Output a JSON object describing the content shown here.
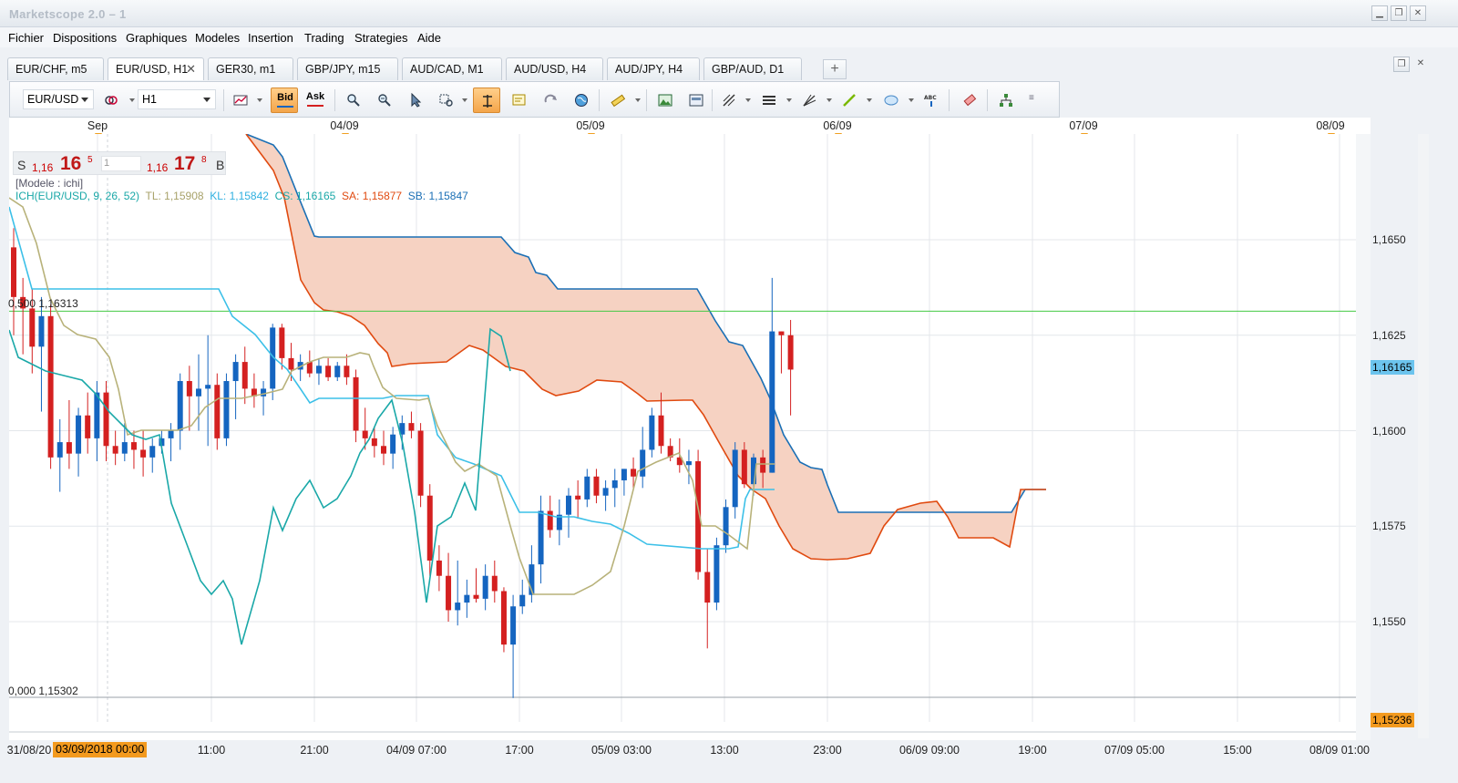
{
  "window": {
    "title": "Marketscope 2.0 – 1"
  },
  "menu": [
    "Fichier",
    "Dispositions",
    "Graphiques",
    "Modeles",
    "Insertion",
    "Trading",
    "Strategies",
    "Aide"
  ],
  "tabs": [
    "EUR/CHF, m5",
    "EUR/USD, H1",
    "GER30, m1",
    "GBP/JPY, m15",
    "AUD/CAD, M1",
    "AUD/USD, H4",
    "AUD/JPY, H4",
    "GBP/AUD, D1"
  ],
  "active_tab": 1,
  "toolbar": {
    "symbol": "EUR/USD",
    "timeframe": "H1",
    "bid_label": "Bid",
    "ask_label": "Ask"
  },
  "quote": {
    "sell_letter": "S",
    "sell_prefix": "1,16",
    "sell_big": "16",
    "sell_sup": "5",
    "lot": "1",
    "buy_prefix": "1,16",
    "buy_big": "17",
    "buy_sup": "8",
    "buy_letter": "B"
  },
  "model_label": "[Modele : ichi]",
  "ichimoku": {
    "name": "ICH(EUR/USD, 9, 26, 52)",
    "tl": "TL: 1,15908",
    "kl": "KL: 1,15842",
    "cs": "CS: 1,16165",
    "sa": "SA: 1,15877",
    "sb": "SB: 1,15847",
    "colors": {
      "tl": "#b8b27a",
      "kl": "#3cc0e8",
      "cs": "#1aa8a8",
      "sa": "#e04a10",
      "sb": "#1a6fb5",
      "cloud": "#f6d2c2"
    }
  },
  "fib": {
    "upper": "0,500 1,16313",
    "lower": "0,000 1,15302"
  },
  "date_strip": [
    "Sep",
    "04/09",
    "05/09",
    "06/09",
    "07/09",
    "08/09"
  ],
  "price_axis": [
    "1,1650",
    "1,1625",
    "1,1600",
    "1,1575",
    "1,1550"
  ],
  "price_tags": {
    "current": "1,16165",
    "low": "1,15236"
  },
  "time_axis": [
    "31/08/20",
    "03/09/2018 00:00",
    "11:00",
    "21:00",
    "04/09 07:00",
    "17:00",
    "05/09 03:00",
    "13:00",
    "23:00",
    "06/09 09:00",
    "19:00",
    "07/09 05:00",
    "15:00",
    "08/09 01:00"
  ],
  "chart_data": {
    "type": "candlestick",
    "symbol": "EUR/USD",
    "timeframe": "H1",
    "ylim": [
      1.1523,
      1.1672
    ],
    "price_ticks": [
      1.165,
      1.1625,
      1.16,
      1.1575,
      1.155
    ],
    "fib_levels": [
      {
        "label": "0,500",
        "value": 1.16313
      },
      {
        "label": "0,000",
        "value": 1.15302
      }
    ],
    "current_price": 1.16165,
    "bull_color": "#1565c0",
    "bear_color": "#d42020",
    "candles": [
      [
        1.1648,
        1.1653,
        1.1625,
        1.1635
      ],
      [
        1.1635,
        1.164,
        1.162,
        1.1632
      ],
      [
        1.1632,
        1.1637,
        1.1615,
        1.1622
      ],
      [
        1.1622,
        1.1635,
        1.1605,
        1.163
      ],
      [
        1.163,
        1.1633,
        1.159,
        1.1593
      ],
      [
        1.1593,
        1.1603,
        1.1584,
        1.1597
      ],
      [
        1.1597,
        1.1608,
        1.159,
        1.1594
      ],
      [
        1.1594,
        1.1606,
        1.1588,
        1.1604
      ],
      [
        1.1604,
        1.161,
        1.1594,
        1.1598
      ],
      [
        1.1598,
        1.1613,
        1.1592,
        1.161
      ],
      [
        1.161,
        1.1613,
        1.1592,
        1.1596
      ],
      [
        1.1596,
        1.16,
        1.1591,
        1.1594
      ],
      [
        1.1594,
        1.1602,
        1.1592,
        1.1597
      ],
      [
        1.1597,
        1.16,
        1.159,
        1.1595
      ],
      [
        1.1595,
        1.16,
        1.1588,
        1.1593
      ],
      [
        1.1593,
        1.1598,
        1.1589,
        1.1596
      ],
      [
        1.1596,
        1.16,
        1.1594,
        1.1598
      ],
      [
        1.1598,
        1.1602,
        1.1592,
        1.16
      ],
      [
        1.16,
        1.1615,
        1.1595,
        1.1613
      ],
      [
        1.1613,
        1.1617,
        1.16,
        1.1609
      ],
      [
        1.1609,
        1.162,
        1.16,
        1.1611
      ],
      [
        1.1611,
        1.1625,
        1.1596,
        1.1612
      ],
      [
        1.1612,
        1.1615,
        1.1595,
        1.1598
      ],
      [
        1.1598,
        1.1615,
        1.1596,
        1.1613
      ],
      [
        1.1613,
        1.162,
        1.1603,
        1.1618
      ],
      [
        1.1618,
        1.1622,
        1.1607,
        1.1611
      ],
      [
        1.1611,
        1.1615,
        1.1606,
        1.1609
      ],
      [
        1.1609,
        1.1613,
        1.1604,
        1.1611
      ],
      [
        1.1611,
        1.1628,
        1.1608,
        1.1627
      ],
      [
        1.1627,
        1.1628,
        1.1616,
        1.1619
      ],
      [
        1.1619,
        1.1623,
        1.1613,
        1.1616
      ],
      [
        1.1616,
        1.162,
        1.1613,
        1.1618
      ],
      [
        1.1618,
        1.1621,
        1.1614,
        1.1615
      ],
      [
        1.1615,
        1.1619,
        1.1612,
        1.1617
      ],
      [
        1.1617,
        1.1619,
        1.1613,
        1.1614
      ],
      [
        1.1614,
        1.1618,
        1.1613,
        1.1617
      ],
      [
        1.1617,
        1.162,
        1.1612,
        1.1614
      ],
      [
        1.1614,
        1.1616,
        1.1597,
        1.16
      ],
      [
        1.16,
        1.1606,
        1.1595,
        1.1598
      ],
      [
        1.1598,
        1.1601,
        1.1593,
        1.1596
      ],
      [
        1.1596,
        1.16,
        1.1591,
        1.1594
      ],
      [
        1.1594,
        1.1601,
        1.159,
        1.1599
      ],
      [
        1.1599,
        1.1604,
        1.1595,
        1.1602
      ],
      [
        1.1602,
        1.1605,
        1.1598,
        1.16
      ],
      [
        1.16,
        1.1602,
        1.158,
        1.1583
      ],
      [
        1.1583,
        1.1586,
        1.1562,
        1.1566
      ],
      [
        1.1566,
        1.157,
        1.1558,
        1.1562
      ],
      [
        1.1562,
        1.1568,
        1.155,
        1.1553
      ],
      [
        1.1553,
        1.1566,
        1.1549,
        1.1555
      ],
      [
        1.1555,
        1.1561,
        1.1551,
        1.1557
      ],
      [
        1.1557,
        1.1564,
        1.1555,
        1.1556
      ],
      [
        1.1556,
        1.1565,
        1.1553,
        1.1562
      ],
      [
        1.1562,
        1.1566,
        1.1555,
        1.1558
      ],
      [
        1.1558,
        1.1559,
        1.1542,
        1.1544
      ],
      [
        1.1544,
        1.1557,
        1.153,
        1.1554
      ],
      [
        1.1554,
        1.1561,
        1.1552,
        1.1557
      ],
      [
        1.1557,
        1.157,
        1.1555,
        1.1565
      ],
      [
        1.1565,
        1.1583,
        1.156,
        1.1579
      ],
      [
        1.1579,
        1.1583,
        1.1572,
        1.1574
      ],
      [
        1.1574,
        1.1582,
        1.157,
        1.1578
      ],
      [
        1.1578,
        1.1585,
        1.1572,
        1.1583
      ],
      [
        1.1583,
        1.1587,
        1.1577,
        1.1582
      ],
      [
        1.1582,
        1.159,
        1.158,
        1.1588
      ],
      [
        1.1588,
        1.159,
        1.1581,
        1.1583
      ],
      [
        1.1583,
        1.1587,
        1.1579,
        1.1585
      ],
      [
        1.1585,
        1.159,
        1.158,
        1.1587
      ],
      [
        1.1587,
        1.159,
        1.1583,
        1.159
      ],
      [
        1.159,
        1.1593,
        1.1585,
        1.1588
      ],
      [
        1.1588,
        1.1601,
        1.1585,
        1.1595
      ],
      [
        1.1595,
        1.1606,
        1.1593,
        1.1604
      ],
      [
        1.1604,
        1.161,
        1.1594,
        1.1596
      ],
      [
        1.1596,
        1.1598,
        1.1592,
        1.1593
      ],
      [
        1.1593,
        1.1598,
        1.1589,
        1.1591
      ],
      [
        1.1591,
        1.1595,
        1.1586,
        1.1592
      ],
      [
        1.1592,
        1.1595,
        1.1561,
        1.1563
      ],
      [
        1.1563,
        1.1569,
        1.1543,
        1.1555
      ],
      [
        1.1555,
        1.1572,
        1.1553,
        1.157
      ],
      [
        1.157,
        1.1582,
        1.1568,
        1.158
      ],
      [
        1.158,
        1.1597,
        1.1577,
        1.1595
      ],
      [
        1.1595,
        1.1597,
        1.1585,
        1.1586
      ],
      [
        1.1586,
        1.1594,
        1.1583,
        1.1593
      ],
      [
        1.1593,
        1.1595,
        1.1585,
        1.1589
      ],
      [
        1.1589,
        1.164,
        1.1589,
        1.1626
      ],
      [
        1.1626,
        1.1626,
        1.1615,
        1.1625
      ],
      [
        1.1625,
        1.1629,
        1.1604,
        1.1616
      ]
    ]
  }
}
